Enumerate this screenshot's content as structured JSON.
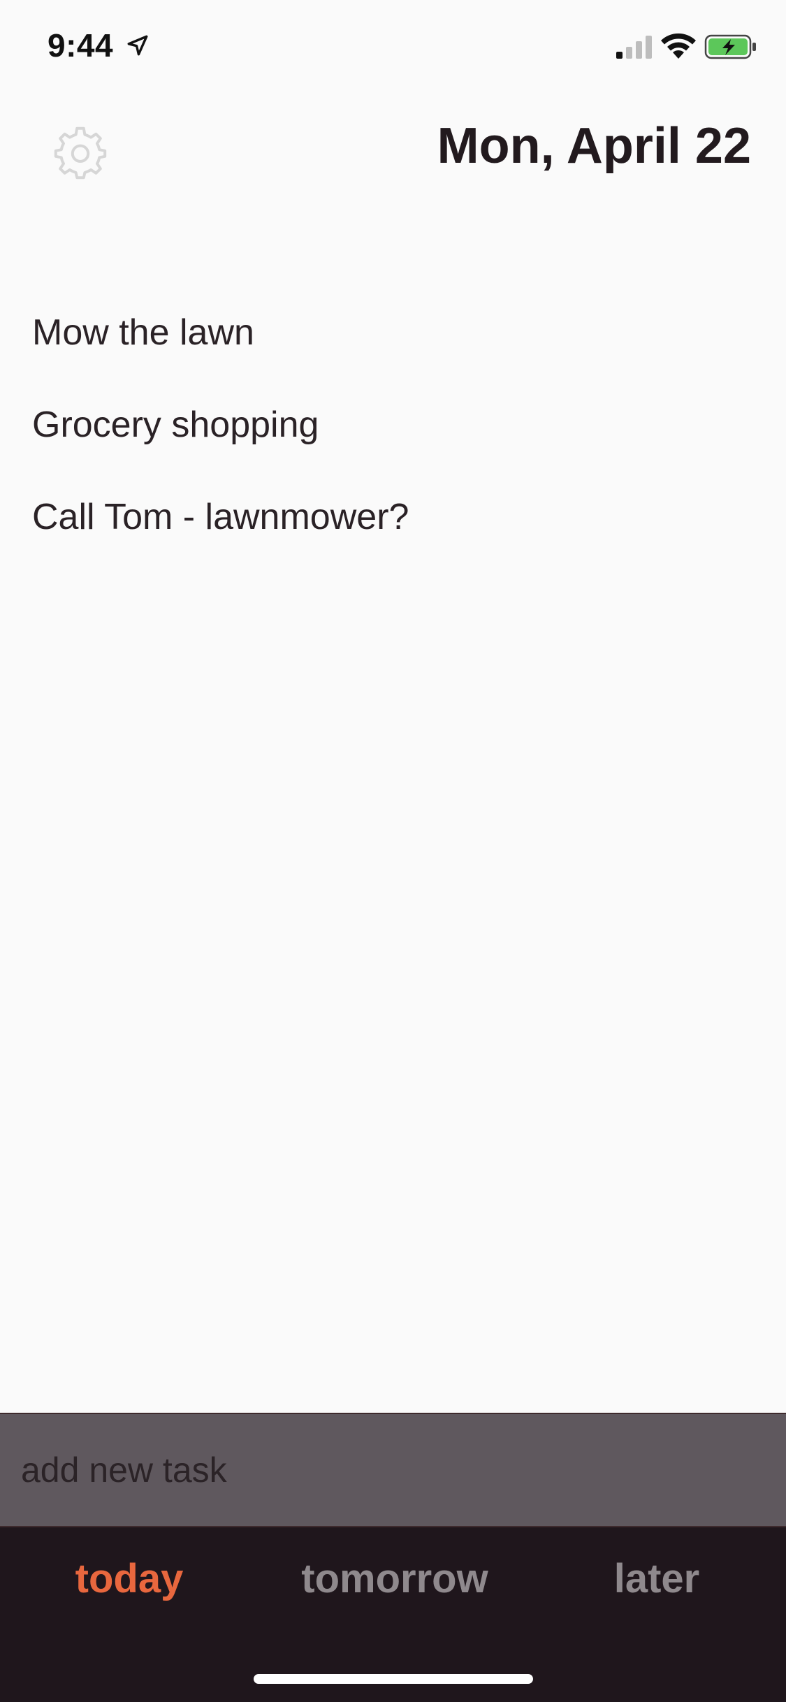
{
  "status_bar": {
    "time": "9:44",
    "icons": [
      "location-arrow-icon",
      "cellular-signal-icon",
      "wifi-icon",
      "battery-charging-icon"
    ],
    "battery_color": "#5cc75a"
  },
  "header": {
    "settings_icon": "gear-icon",
    "title": "Mon, April 22"
  },
  "tasks": [
    {
      "label": "Mow the lawn"
    },
    {
      "label": "Grocery shopping"
    },
    {
      "label": "Call Tom - lawnmower?"
    }
  ],
  "add_task": {
    "placeholder": "add new task",
    "value": ""
  },
  "tabs": [
    {
      "label": "today",
      "active": true
    },
    {
      "label": "tomorrow",
      "active": false
    },
    {
      "label": "later",
      "active": false
    }
  ],
  "colors": {
    "accent": "#e8673e",
    "tab_bar_bg": "#1f161c",
    "input_bg": "#5f585e",
    "inactive_tab": "#8f898d"
  }
}
